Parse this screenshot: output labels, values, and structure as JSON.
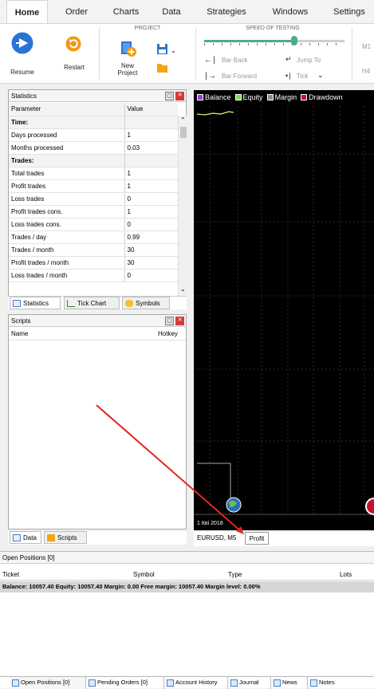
{
  "menu": {
    "items": [
      {
        "label": "Home",
        "active": true
      },
      {
        "label": "Order"
      },
      {
        "label": "Charts"
      },
      {
        "label": "Data"
      },
      {
        "label": "Strategies"
      },
      {
        "label": "Windows"
      },
      {
        "label": "Settings"
      }
    ]
  },
  "ribbon": {
    "project_group_title": "PROJECT",
    "speed_group_title": "SPEED OF TESTING",
    "resume_label": "Resume",
    "restart_label": "Restart",
    "new_project_label": "New\nProject",
    "bar_back_label": "Bar Back",
    "bar_forward_label": "Bar Forward",
    "jump_to_label": "Jump To",
    "tick_label": "Tick",
    "tf_m1": "M1",
    "tf_h4": "H4",
    "speed_slider_value": 0.64
  },
  "statistics": {
    "title": "Statistics",
    "col_param": "Parameter",
    "col_value": "Value",
    "rows": [
      {
        "p": "Time:",
        "v": "",
        "section": true
      },
      {
        "p": "Days processed",
        "v": "1"
      },
      {
        "p": "Months processed",
        "v": "0.03"
      },
      {
        "p": "Trades:",
        "v": "",
        "section": true
      },
      {
        "p": "Total trades",
        "v": "1"
      },
      {
        "p": "Profit trades",
        "v": "1"
      },
      {
        "p": "Loss trades",
        "v": "0"
      },
      {
        "p": "Profit trades cons.",
        "v": "1"
      },
      {
        "p": "Loss trades cons.",
        "v": "0"
      },
      {
        "p": "Trades / day",
        "v": "0.99"
      },
      {
        "p": "Trades / month",
        "v": "30"
      },
      {
        "p": "Profit trades / month",
        "v": "30"
      },
      {
        "p": "Loss trades / month",
        "v": "0"
      }
    ],
    "tabs": [
      "Statistics",
      "Tick Chart",
      "Symbols"
    ]
  },
  "scripts": {
    "title": "Scripts",
    "col_name": "Name",
    "col_hotkey": "Hotkey",
    "tabs": [
      "Data",
      "Scripts"
    ]
  },
  "chart": {
    "legend": [
      {
        "label": "Balance",
        "color": "#9b3fd6"
      },
      {
        "label": "Equity",
        "color": "#7ed957"
      },
      {
        "label": "Margin",
        "color": "#8c8c8c"
      },
      {
        "label": "Drawdown",
        "color": "#c8102e"
      }
    ],
    "date_label": "1 Кві 2018",
    "tabs": [
      "EURUSD, M5",
      "Profit"
    ]
  },
  "positions": {
    "title": "Open Positions [0]",
    "columns": [
      "Ticket",
      "Symbol",
      "Type",
      "Lots"
    ],
    "summary": "Balance: 10057.40 Equity: 10057.40 Margin: 0.00 Free margin: 10057.40 Margin level: 0.00%"
  },
  "bottom_tabs": [
    "Open Positions [0]",
    "Pending Orders [0]",
    "Account History",
    "Journal",
    "News",
    "Notes"
  ]
}
